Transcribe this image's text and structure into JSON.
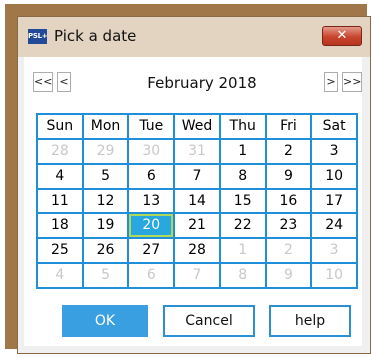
{
  "window": {
    "title": "Pick a date",
    "app_icon_text": "PSL+",
    "close_label": "✕"
  },
  "nav": {
    "prev_year": "<<",
    "prev_month": "<",
    "month_label": "February 2018",
    "next_month": ">",
    "next_year": ">>"
  },
  "calendar": {
    "weekdays": [
      "Sun",
      "Mon",
      "Tue",
      "Wed",
      "Thu",
      "Fri",
      "Sat"
    ],
    "selected": "20",
    "weeks": [
      [
        {
          "d": "28",
          "o": true
        },
        {
          "d": "29",
          "o": true
        },
        {
          "d": "30",
          "o": true
        },
        {
          "d": "31",
          "o": true
        },
        {
          "d": "1"
        },
        {
          "d": "2"
        },
        {
          "d": "3"
        }
      ],
      [
        {
          "d": "4"
        },
        {
          "d": "5"
        },
        {
          "d": "6"
        },
        {
          "d": "7"
        },
        {
          "d": "8"
        },
        {
          "d": "9"
        },
        {
          "d": "10"
        }
      ],
      [
        {
          "d": "11"
        },
        {
          "d": "12"
        },
        {
          "d": "13"
        },
        {
          "d": "14"
        },
        {
          "d": "15"
        },
        {
          "d": "16"
        },
        {
          "d": "17"
        }
      ],
      [
        {
          "d": "18"
        },
        {
          "d": "19"
        },
        {
          "d": "20",
          "sel": true
        },
        {
          "d": "21"
        },
        {
          "d": "22"
        },
        {
          "d": "23"
        },
        {
          "d": "24"
        }
      ],
      [
        {
          "d": "25"
        },
        {
          "d": "26"
        },
        {
          "d": "27"
        },
        {
          "d": "28"
        },
        {
          "d": "1",
          "o": true
        },
        {
          "d": "2",
          "o": true
        },
        {
          "d": "3",
          "o": true
        }
      ],
      [
        {
          "d": "4",
          "o": true
        },
        {
          "d": "5",
          "o": true
        },
        {
          "d": "6",
          "o": true
        },
        {
          "d": "7",
          "o": true
        },
        {
          "d": "8",
          "o": true
        },
        {
          "d": "9",
          "o": true
        },
        {
          "d": "10",
          "o": true
        }
      ]
    ]
  },
  "buttons": {
    "ok": "OK",
    "cancel": "Cancel",
    "help": "help"
  },
  "colors": {
    "frame": "#a07749",
    "grid_line": "#1e8fd8",
    "selected_bg": "#29a8e0",
    "selected_border": "#b0d85a",
    "ok_bg": "#3a9fe0"
  }
}
